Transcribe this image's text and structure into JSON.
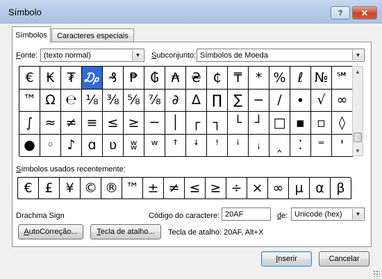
{
  "window": {
    "title": "Símbolo",
    "help_label": "?",
    "close_label": "✕"
  },
  "tabs": [
    {
      "label": "Símbolos",
      "selected": true
    },
    {
      "label": "Caracteres especiais",
      "selected": false
    }
  ],
  "font": {
    "label_ul": "F",
    "label_rest": "onte:",
    "value": "(texto normal)"
  },
  "subset": {
    "label_ul": "S",
    "label_rest": "ubconjunto:",
    "value": "Símbolos de Moeda"
  },
  "symbols": [
    "€",
    "₭",
    "₮",
    "₯",
    "₰",
    "₱",
    "₲",
    "₳",
    "₴",
    "₵",
    "₸",
    "*",
    "%",
    "ℓ",
    "№",
    "℠",
    "™",
    "Ω",
    "℮",
    "⅛",
    "⅜",
    "⅝",
    "⅞",
    "∂",
    "∆",
    "∏",
    "∑",
    "−",
    "∕",
    "∙",
    "√",
    "∞",
    "∫",
    "≈",
    "≠",
    "≡",
    "≤",
    "≥",
    "─",
    "│",
    "┌",
    "┐",
    "└",
    "┘",
    "□",
    "▪",
    "▫",
    "◊",
    "●",
    "◦",
    "♪",
    "ɑ",
    "ʋ",
    "ʬ",
    "ʷ",
    "ꜛ",
    "ꜜ",
    "ꜝ",
    "ꜞ",
    "ꜟ",
    "‸",
    "⁚",
    "⁼",
    "ꞌ"
  ],
  "selected_symbol_index": 3,
  "recent": {
    "label_ul": "S",
    "label_rest": "ímbolos usados recentemente:",
    "symbols": [
      "€",
      "£",
      "¥",
      "©",
      "®",
      "™",
      "±",
      "≠",
      "≤",
      "≥",
      "÷",
      "×",
      "∞",
      "µ",
      "α",
      "β"
    ]
  },
  "char_name": "Drachma Sign",
  "char_code": {
    "label": "Código do caractere:",
    "value": "20AF"
  },
  "from": {
    "label_ul": "d",
    "label_rest": "e:",
    "value": "Unicode (hex)"
  },
  "buttons": {
    "autocorrect_ul": "A",
    "autocorrect_rest": "utoCorreção...",
    "shortcut_ul": "T",
    "shortcut_rest": "ecla de atalho...",
    "insert_ul": "I",
    "insert_rest": "nserir",
    "cancel": "Cancelar"
  },
  "shortcut_text": "Tecla de atalho: 20AF, Alt+X"
}
